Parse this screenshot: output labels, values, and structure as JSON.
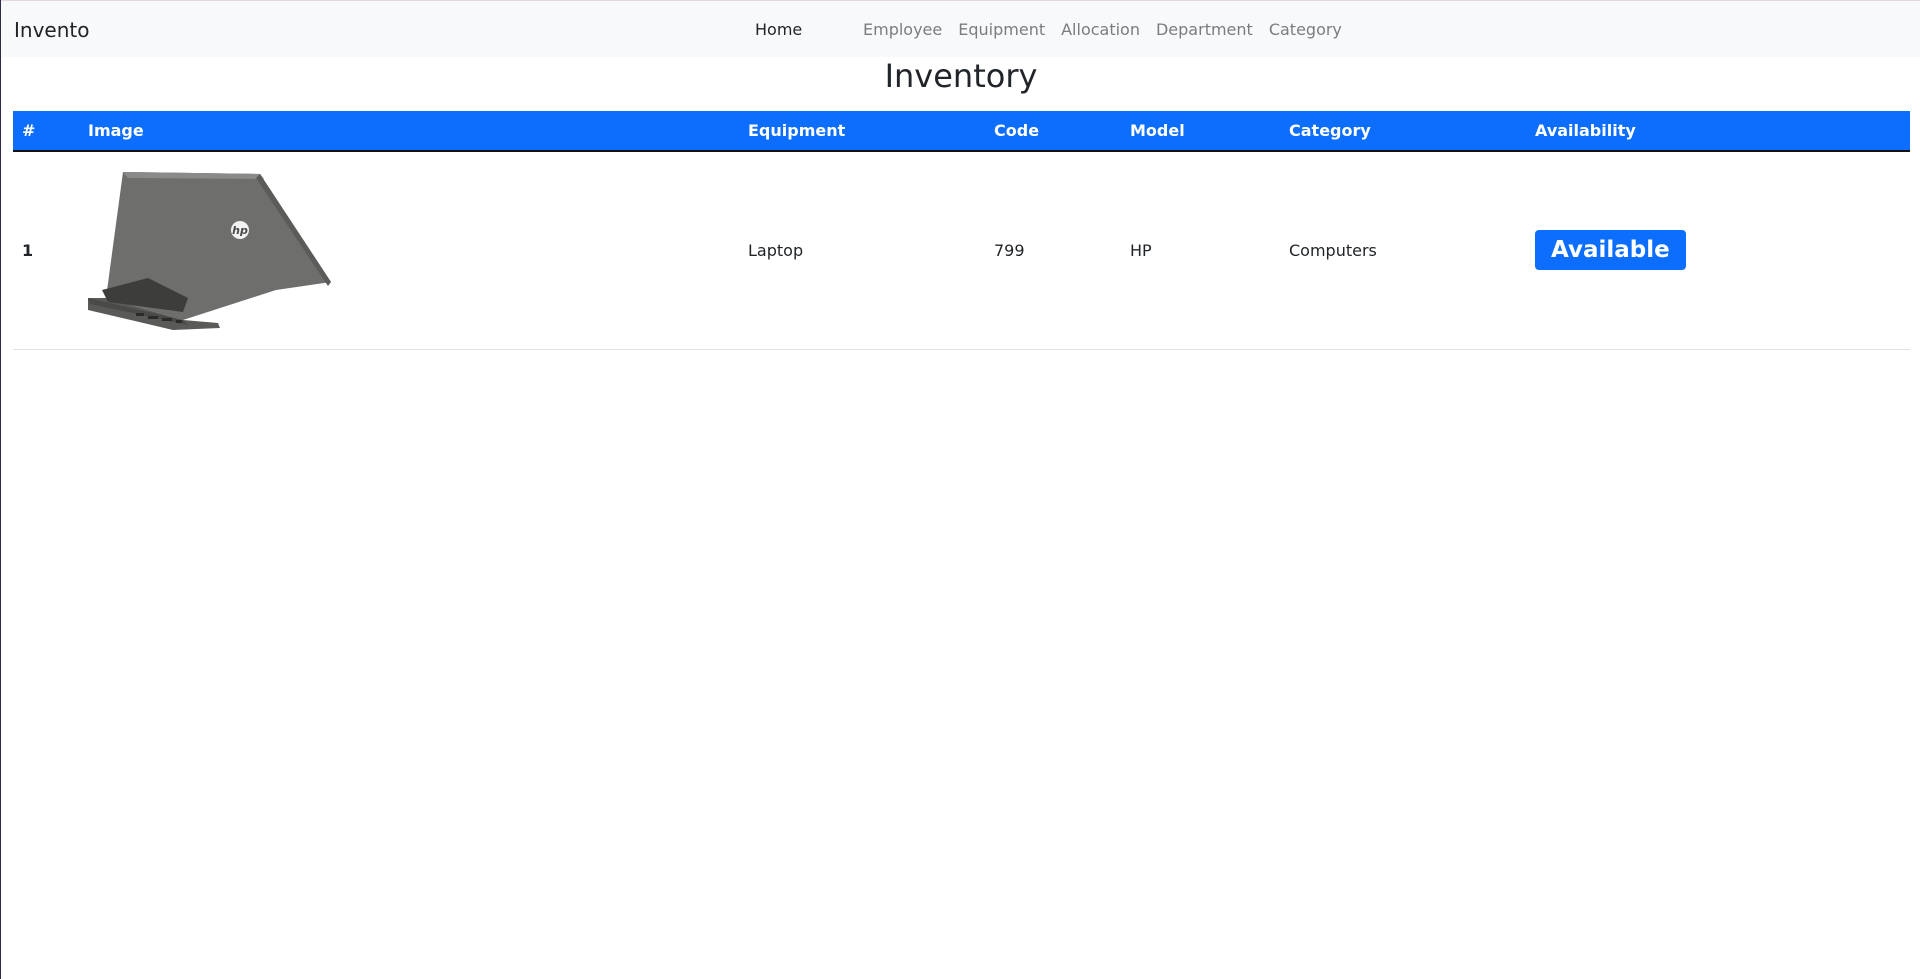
{
  "navbar": {
    "brand": "Invento",
    "home": "Home",
    "links": [
      "Employee",
      "Equipment",
      "Allocation",
      "Department",
      "Category"
    ]
  },
  "page": {
    "title": "Inventory"
  },
  "table": {
    "headers": [
      "#",
      "Image",
      "Equipment",
      "Code",
      "Model",
      "Category",
      "Availability"
    ],
    "rows": [
      {
        "index": "1",
        "image": "laptop-image",
        "equipment": "Laptop",
        "code": "799",
        "model": "HP",
        "category": "Computers",
        "availability": "Available"
      }
    ]
  },
  "colors": {
    "primary": "#0d6efd",
    "navbar_bg": "#f8f9fa",
    "nav_link": "#7a7d80"
  }
}
